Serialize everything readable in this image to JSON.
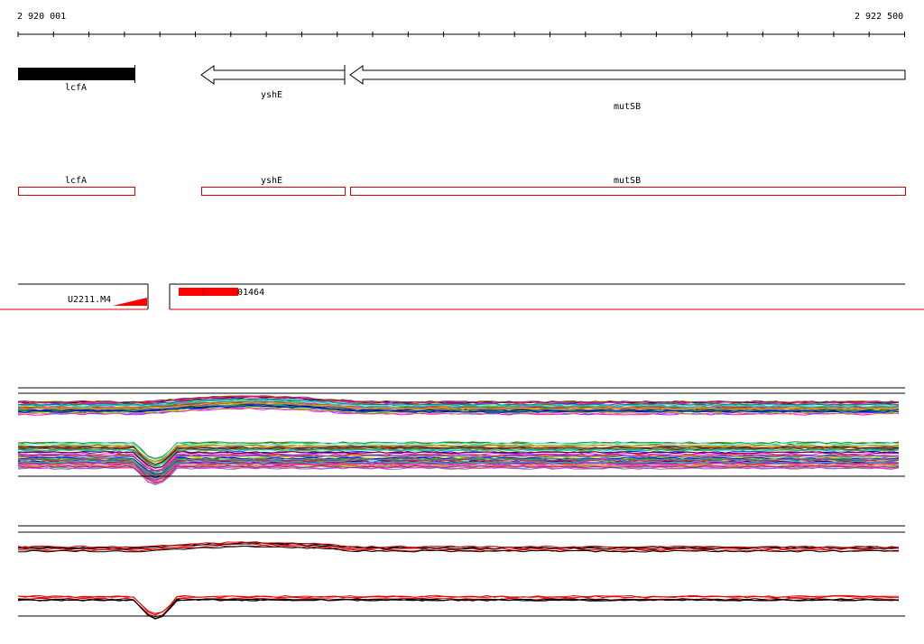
{
  "ruler": {
    "start_label": "2 920 001",
    "end_label": "2 922 500"
  },
  "genes": [
    {
      "label": "lcfA",
      "strand": "solid"
    },
    {
      "label": "yshE",
      "strand": "reverse"
    },
    {
      "label": "mutSB",
      "strand": "reverse"
    }
  ],
  "features": [
    {
      "label": "lcfA"
    },
    {
      "label": "yshE"
    },
    {
      "label": "mutSB"
    }
  ],
  "probes": {
    "left_label": "U2211.M4",
    "right_label": "01464"
  },
  "colors": {
    "feature_outline": "#d40000",
    "probe_fill": "#ff0000",
    "divider": "#d40000",
    "gene_fill": "#000000"
  }
}
